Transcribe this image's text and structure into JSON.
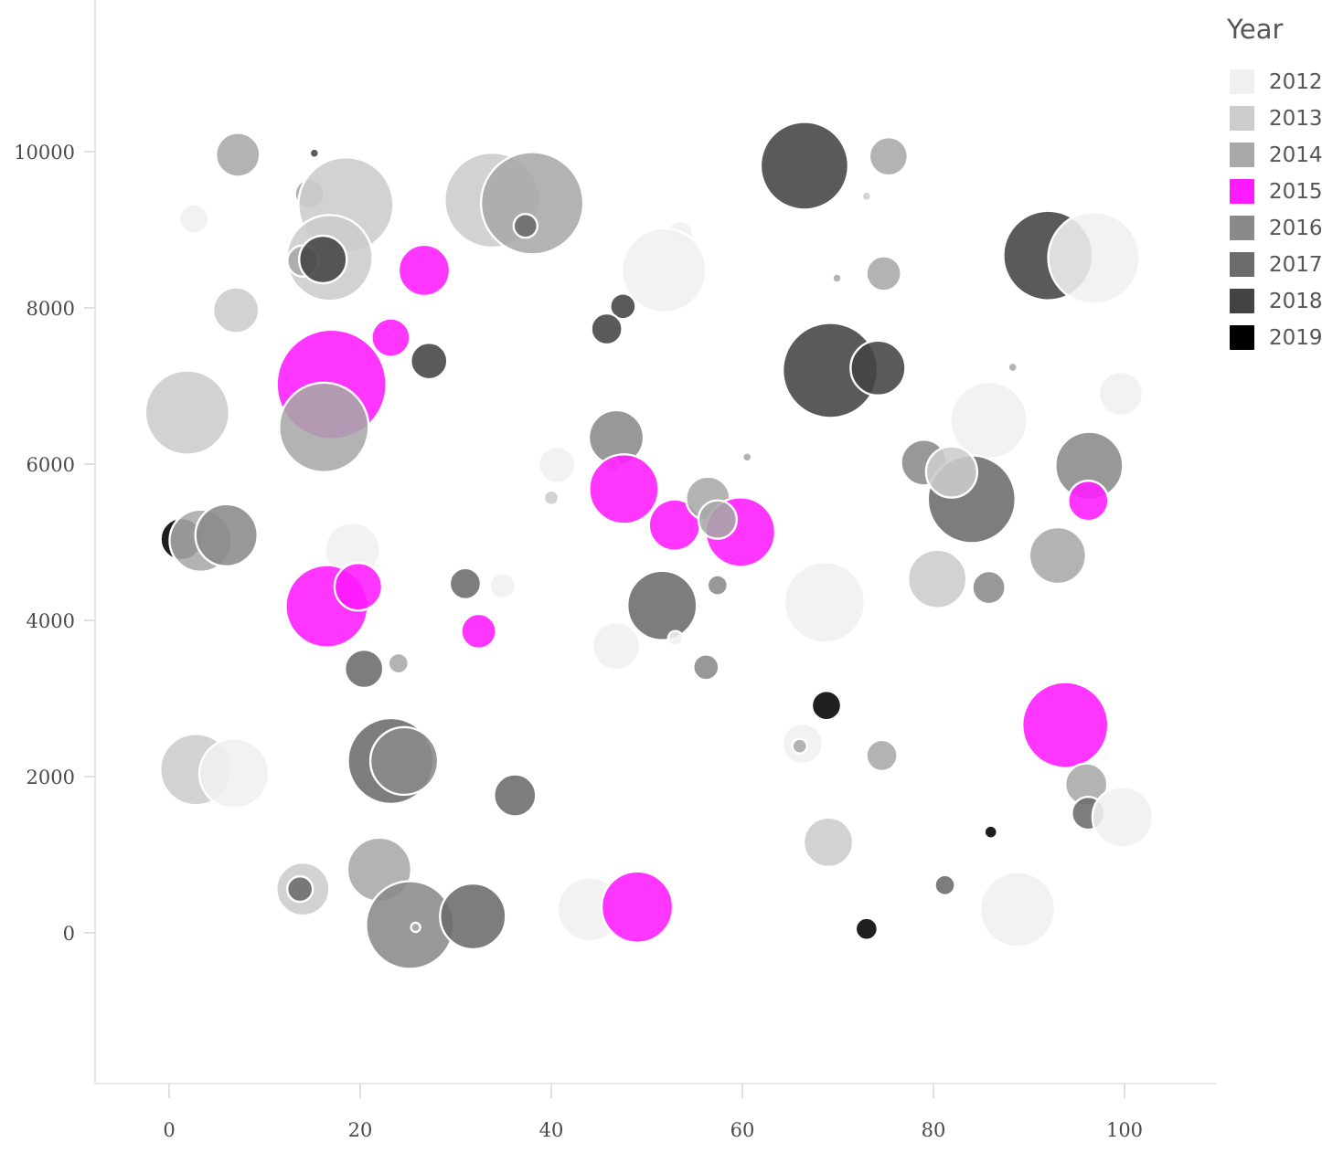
{
  "legend": {
    "title": "Year",
    "entries": [
      {
        "label": "2012",
        "color": "#f0f0f0"
      },
      {
        "label": "2013",
        "color": "#cccccc"
      },
      {
        "label": "2014",
        "color": "#a8a8a8"
      },
      {
        "label": "2015",
        "color": "#ff1aff"
      },
      {
        "label": "2016",
        "color": "#8a8a8a"
      },
      {
        "label": "2017",
        "color": "#6b6b6b"
      },
      {
        "label": "2018",
        "color": "#434343"
      },
      {
        "label": "2019",
        "color": "#000000"
      }
    ]
  },
  "chart_data": {
    "type": "scatter",
    "title": "",
    "xlabel": "",
    "ylabel": "",
    "xlim": [
      -4,
      108
    ],
    "ylim": [
      -1200,
      11600
    ],
    "grid": false,
    "legend_position": "right",
    "legend_title": "Year",
    "size_encoding": "bubble area",
    "color_map": {
      "2012": "#f0f0f0",
      "2013": "#cccccc",
      "2014": "#a8a8a8",
      "2015": "#ff1aff",
      "2016": "#8a8a8a",
      "2017": "#6b6b6b",
      "2018": "#434343",
      "2019": "#000000"
    },
    "x_ticks": [
      0,
      20,
      40,
      60,
      80,
      100
    ],
    "y_ticks": [
      0,
      2000,
      4000,
      6000,
      8000,
      10000
    ],
    "points": [
      {
        "x": 7.2,
        "y": 9960,
        "r": 24,
        "year": "2014"
      },
      {
        "x": 15.2,
        "y": 9980,
        "r": 5,
        "year": "2018"
      },
      {
        "x": 14.7,
        "y": 9460,
        "r": 16,
        "year": "2014"
      },
      {
        "x": 18.5,
        "y": 9320,
        "r": 52,
        "year": "2013"
      },
      {
        "x": 2.6,
        "y": 9140,
        "r": 16,
        "year": "2012"
      },
      {
        "x": 33.8,
        "y": 9380,
        "r": 52,
        "year": "2013"
      },
      {
        "x": 38.0,
        "y": 9340,
        "r": 56,
        "year": "2014"
      },
      {
        "x": 37.3,
        "y": 9050,
        "r": 13,
        "year": "2017"
      },
      {
        "x": 66.5,
        "y": 9820,
        "r": 48,
        "year": "2018"
      },
      {
        "x": 75.3,
        "y": 9940,
        "r": 21,
        "year": "2014"
      },
      {
        "x": 73.0,
        "y": 9430,
        "r": 5,
        "year": "2013"
      },
      {
        "x": 16.8,
        "y": 8640,
        "r": 47,
        "year": "2013"
      },
      {
        "x": 14.0,
        "y": 8600,
        "r": 17,
        "year": "2014"
      },
      {
        "x": 16.1,
        "y": 8620,
        "r": 26,
        "year": "2018"
      },
      {
        "x": 7.0,
        "y": 7970,
        "r": 25,
        "year": "2013"
      },
      {
        "x": 26.7,
        "y": 8480,
        "r": 28,
        "year": "2015"
      },
      {
        "x": 53.5,
        "y": 8950,
        "r": 14,
        "year": "2012"
      },
      {
        "x": 51.8,
        "y": 8480,
        "r": 46,
        "year": "2012"
      },
      {
        "x": 69.9,
        "y": 8380,
        "r": 5,
        "year": "2014"
      },
      {
        "x": 74.8,
        "y": 8440,
        "r": 19,
        "year": "2014"
      },
      {
        "x": 92.0,
        "y": 8670,
        "r": 49,
        "year": "2018"
      },
      {
        "x": 96.8,
        "y": 8640,
        "r": 50,
        "year": "2012"
      },
      {
        "x": 23.2,
        "y": 7620,
        "r": 21,
        "year": "2015"
      },
      {
        "x": 47.5,
        "y": 8020,
        "r": 14,
        "year": "2018"
      },
      {
        "x": 45.8,
        "y": 7730,
        "r": 17,
        "year": "2018"
      },
      {
        "x": 17.0,
        "y": 7020,
        "r": 60,
        "year": "2015"
      },
      {
        "x": 27.2,
        "y": 7320,
        "r": 20,
        "year": "2018"
      },
      {
        "x": 69.2,
        "y": 7200,
        "r": 52,
        "year": "2018"
      },
      {
        "x": 74.2,
        "y": 7230,
        "r": 30,
        "year": "2018"
      },
      {
        "x": 88.3,
        "y": 7240,
        "r": 5,
        "year": "2014"
      },
      {
        "x": 1.9,
        "y": 6660,
        "r": 46,
        "year": "2013"
      },
      {
        "x": 16.2,
        "y": 6470,
        "r": 49,
        "year": "2014"
      },
      {
        "x": 46.8,
        "y": 6340,
        "r": 30,
        "year": "2016"
      },
      {
        "x": 85.8,
        "y": 6560,
        "r": 42,
        "year": "2012"
      },
      {
        "x": 96.3,
        "y": 5980,
        "r": 37,
        "year": "2016"
      },
      {
        "x": 99.6,
        "y": 6900,
        "r": 24,
        "year": "2012"
      },
      {
        "x": 40.6,
        "y": 5990,
        "r": 20,
        "year": "2012"
      },
      {
        "x": 46.4,
        "y": 5980,
        "r": 8,
        "year": "2013"
      },
      {
        "x": 60.5,
        "y": 6090,
        "r": 5,
        "year": "2014"
      },
      {
        "x": 79.0,
        "y": 6020,
        "r": 25,
        "year": "2016"
      },
      {
        "x": 84.0,
        "y": 5550,
        "r": 48,
        "year": "2017"
      },
      {
        "x": 81.9,
        "y": 5900,
        "r": 28,
        "year": "2013"
      },
      {
        "x": 47.6,
        "y": 5680,
        "r": 38,
        "year": "2015"
      },
      {
        "x": 52.9,
        "y": 5220,
        "r": 28,
        "year": "2015"
      },
      {
        "x": 56.4,
        "y": 5560,
        "r": 24,
        "year": "2014"
      },
      {
        "x": 59.8,
        "y": 5130,
        "r": 38,
        "year": "2015"
      },
      {
        "x": 57.4,
        "y": 5290,
        "r": 21,
        "year": "2014"
      },
      {
        "x": 40.0,
        "y": 5570,
        "r": 8,
        "year": "2013"
      },
      {
        "x": 96.2,
        "y": 5530,
        "r": 22,
        "year": "2015"
      },
      {
        "x": 1.3,
        "y": 5040,
        "r": 23,
        "year": "2019"
      },
      {
        "x": 3.3,
        "y": 5020,
        "r": 34,
        "year": "2014"
      },
      {
        "x": 6.0,
        "y": 5090,
        "r": 34,
        "year": "2016"
      },
      {
        "x": 19.2,
        "y": 4900,
        "r": 30,
        "year": "2012"
      },
      {
        "x": 93.0,
        "y": 4830,
        "r": 31,
        "year": "2014"
      },
      {
        "x": 80.4,
        "y": 4530,
        "r": 32,
        "year": "2013"
      },
      {
        "x": 85.8,
        "y": 4420,
        "r": 18,
        "year": "2016"
      },
      {
        "x": 16.5,
        "y": 4180,
        "r": 45,
        "year": "2015"
      },
      {
        "x": 19.8,
        "y": 4430,
        "r": 26,
        "year": "2015"
      },
      {
        "x": 31.0,
        "y": 4470,
        "r": 17,
        "year": "2017"
      },
      {
        "x": 34.9,
        "y": 4440,
        "r": 14,
        "year": "2012"
      },
      {
        "x": 51.6,
        "y": 4190,
        "r": 38,
        "year": "2017"
      },
      {
        "x": 57.4,
        "y": 4450,
        "r": 11,
        "year": "2016"
      },
      {
        "x": 68.6,
        "y": 4230,
        "r": 44,
        "year": "2012"
      },
      {
        "x": 32.4,
        "y": 3860,
        "r": 19,
        "year": "2015"
      },
      {
        "x": 46.8,
        "y": 3670,
        "r": 26,
        "year": "2012"
      },
      {
        "x": 53.0,
        "y": 3770,
        "r": 8,
        "year": "2012"
      },
      {
        "x": 56.2,
        "y": 3400,
        "r": 14,
        "year": "2016"
      },
      {
        "x": 20.4,
        "y": 3380,
        "r": 21,
        "year": "2017"
      },
      {
        "x": 24.0,
        "y": 3450,
        "r": 11,
        "year": "2014"
      },
      {
        "x": 68.8,
        "y": 2910,
        "r": 16,
        "year": "2019"
      },
      {
        "x": 93.8,
        "y": 2660,
        "r": 47,
        "year": "2015"
      },
      {
        "x": 23.2,
        "y": 2200,
        "r": 47,
        "year": "2017"
      },
      {
        "x": 24.6,
        "y": 2200,
        "r": 37,
        "year": "2016"
      },
      {
        "x": 2.8,
        "y": 2090,
        "r": 39,
        "year": "2013"
      },
      {
        "x": 6.8,
        "y": 2040,
        "r": 38,
        "year": "2012"
      },
      {
        "x": 36.2,
        "y": 1760,
        "r": 23,
        "year": "2017"
      },
      {
        "x": 66.3,
        "y": 2420,
        "r": 22,
        "year": "2012"
      },
      {
        "x": 66.0,
        "y": 2390,
        "r": 8,
        "year": "2014"
      },
      {
        "x": 74.6,
        "y": 2270,
        "r": 17,
        "year": "2014"
      },
      {
        "x": 96.0,
        "y": 1900,
        "r": 23,
        "year": "2014"
      },
      {
        "x": 96.2,
        "y": 1530,
        "r": 18,
        "year": "2017"
      },
      {
        "x": 99.8,
        "y": 1480,
        "r": 33,
        "year": "2012"
      },
      {
        "x": 69.0,
        "y": 1160,
        "r": 27,
        "year": "2013"
      },
      {
        "x": 86.0,
        "y": 1290,
        "r": 7,
        "year": "2019"
      },
      {
        "x": 14.0,
        "y": 560,
        "r": 29,
        "year": "2013"
      },
      {
        "x": 13.7,
        "y": 560,
        "r": 14,
        "year": "2017"
      },
      {
        "x": 22.0,
        "y": 810,
        "r": 35,
        "year": "2014"
      },
      {
        "x": 81.2,
        "y": 610,
        "r": 11,
        "year": "2017"
      },
      {
        "x": 25.2,
        "y": 100,
        "r": 48,
        "year": "2016"
      },
      {
        "x": 25.8,
        "y": 70,
        "r": 5,
        "year": "2014"
      },
      {
        "x": 31.8,
        "y": 210,
        "r": 36,
        "year": "2017"
      },
      {
        "x": 44.0,
        "y": 300,
        "r": 35,
        "year": "2012"
      },
      {
        "x": 49.0,
        "y": 330,
        "r": 39,
        "year": "2015"
      },
      {
        "x": 73.0,
        "y": 50,
        "r": 12,
        "year": "2019"
      },
      {
        "x": 88.8,
        "y": 300,
        "r": 41,
        "year": "2012"
      }
    ]
  }
}
